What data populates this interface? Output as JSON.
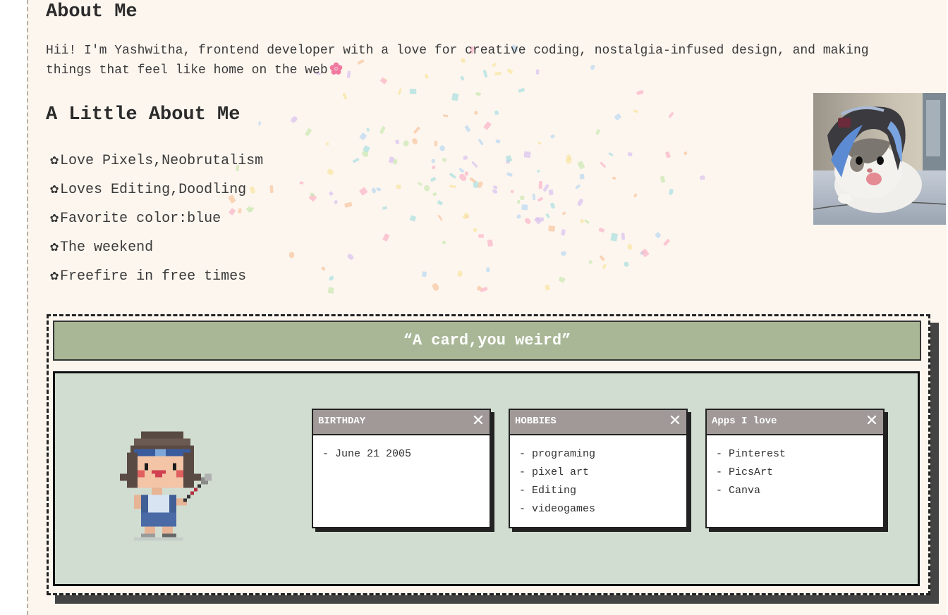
{
  "about": {
    "title": "About Me",
    "intro": "Hii! I'm Yashwitha, frontend developer with a love for creative coding, nostalgia-infused design, and making things that feel like home on the web"
  },
  "little": {
    "title": "A Little About Me",
    "bullet": "✿",
    "facts": [
      "Love Pixels,Neobrutalism",
      "Loves Editing,Doodling",
      "Favorite color:blue",
      "The weekend",
      "Freefire in free times"
    ]
  },
  "card": {
    "title": "“A card,you weird”",
    "windows": [
      {
        "title": "BIRTHDAY",
        "close": "✕",
        "items": [
          "- June 21 2005"
        ]
      },
      {
        "title": "HOBBIES",
        "close": "✕",
        "items": [
          "- programing",
          "- pixel art",
          "- Editing",
          "- videogames"
        ]
      },
      {
        "title": "Apps I love",
        "close": "✕",
        "items": [
          "- Pinterest",
          "- PicsArt",
          "- Canva"
        ]
      }
    ]
  },
  "colors": {
    "page_bg": "#fdf6ef",
    "card_header": "#a9b797",
    "card_body": "#d2ddd1",
    "window_bar": "#a09998"
  },
  "icons": {
    "intro_emoji": "cherry-blossom-icon",
    "close": "close-icon",
    "photo": "cat-photo",
    "sprite": "pixel-character-sprite"
  }
}
